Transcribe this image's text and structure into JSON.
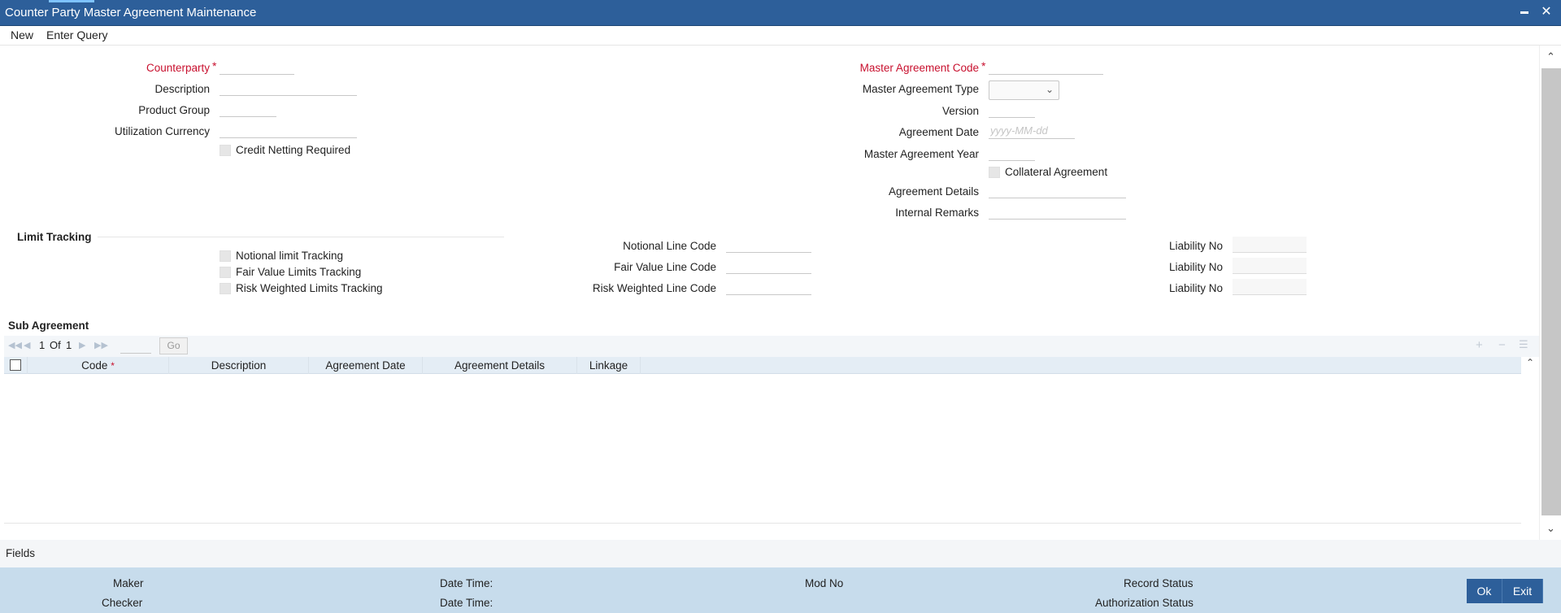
{
  "window": {
    "title": "Counter Party Master Agreement Maintenance",
    "minimize": "▬",
    "close": "✕"
  },
  "menu": {
    "new": "New",
    "enter_query": "Enter Query"
  },
  "form": {
    "counterparty": "Counterparty",
    "description": "Description",
    "product_group": "Product Group",
    "utilization_currency": "Utilization Currency",
    "credit_netting": "Credit Netting Required",
    "master_agreement_code": "Master Agreement Code",
    "master_agreement_type": "Master Agreement Type",
    "version": "Version",
    "agreement_date": "Agreement Date",
    "agreement_date_placeholder": "yyyy-MM-dd",
    "master_agreement_year": "Master Agreement Year",
    "collateral_agreement": "Collateral Agreement",
    "agreement_details": "Agreement Details",
    "internal_remarks": "Internal Remarks",
    "required_mark": "*"
  },
  "limit_tracking": {
    "title": "Limit Tracking",
    "notional_tracking": "Notional limit Tracking",
    "fair_value_tracking": "Fair Value Limits Tracking",
    "risk_weighted_tracking": "Risk Weighted Limits Tracking",
    "notional_line_code": "Notional Line Code",
    "fair_value_line_code": "Fair Value Line Code",
    "risk_weighted_line_code": "Risk Weighted Line Code",
    "liability_no": "Liability No"
  },
  "sub_agreement": {
    "title": "Sub Agreement",
    "page_current": "1",
    "page_of": "Of",
    "page_total": "1",
    "go": "Go",
    "columns": [
      "Code",
      "Description",
      "Agreement Date",
      "Agreement Details",
      "Linkage"
    ],
    "required_mark": "*"
  },
  "fields_tab": "Fields",
  "audit": {
    "maker": "Maker",
    "checker": "Checker",
    "date_time": "Date Time:",
    "mod_no": "Mod No",
    "record_status": "Record Status",
    "authorization_status": "Authorization Status"
  },
  "buttons": {
    "ok": "Ok",
    "exit": "Exit"
  }
}
